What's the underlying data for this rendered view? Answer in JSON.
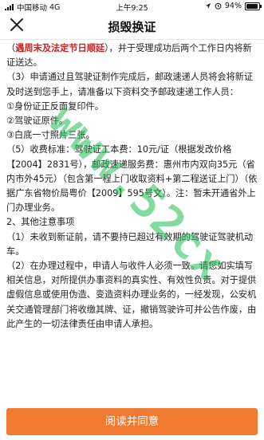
{
  "status": {
    "carrier": "中国移动",
    "network": "4G",
    "time": "上午9:25",
    "battery": "94%",
    "battery_level": 0.94
  },
  "nav": {
    "title": "损毁换证"
  },
  "content": {
    "p0a": "（",
    "p0_highlight": "遇周末及法定节日顺延",
    "p0b": "），并于受理成功后两个工作日内将新证送达。",
    "p1": "（3）申请通过且驾驶证制作完成后，邮政速递人员将会将新证及时送到您手上，请准备以下资料交予邮政速递工作人员：",
    "p2": "①身份证正反面复印件。",
    "p3": "②驾驶证原件。",
    "p4": "③白底一寸照片三张。",
    "p5": "（5）收费标准：驾驶证工本费：10元/证（根据发改价格【2004】2831号），邮政速递服务费：惠州市内双向35元（省内市外45元）（包含第一程上门收取资料+第二程送证上门）（依据广东省物价局粤价【2009】595号文）。注：暂未开通省外上门办理业务。",
    "p6": "2、其他注意事项",
    "p7": "（1）未收到新证前，请不要持已超过有效期的驾驶证驾驶机动车。",
    "p8": "（2）在办理过程中，申请人与收件人必须一致。请您如实填写相关信息，对所提供办事资料的真实性、有效性负责。对于提供虚假信息或使用伪造、变造资料办理业务的，一经发现，公安机关交通管理部门将收缴其牌、证，撤销驾驶许可并公告作废，由此产生的一切法律责任由申请人承担。"
  },
  "watermark": "www.52cx",
  "footer": {
    "button_label": "阅读并同意"
  },
  "colors": {
    "accent": "#f07a30",
    "highlight": "#d01e1e"
  }
}
